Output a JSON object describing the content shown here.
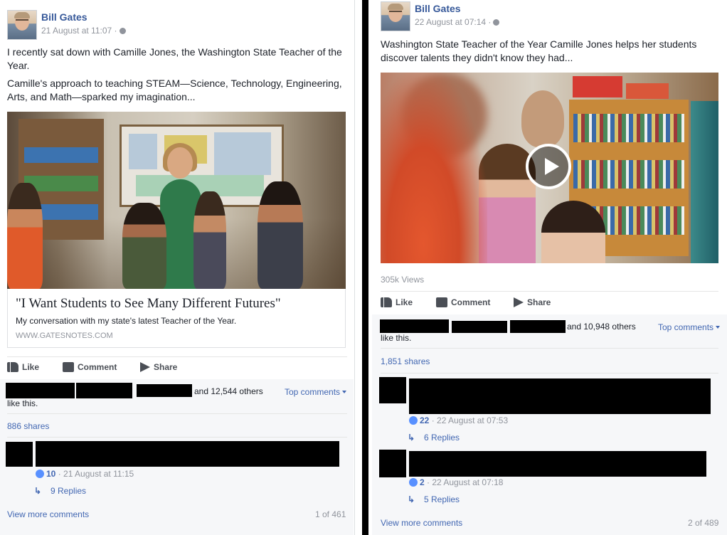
{
  "left": {
    "author": "Bill Gates",
    "timestamp": "21 August at 11:07 ·",
    "text_1": "I recently sat down with Camille Jones, the Washington State Teacher of the Year.",
    "text_2": "Camille's approach to teaching STEAM—Science, Technology, Engineering, Arts, and Math—sparked my imagination...",
    "link_title": "\"I Want Students to See Many Different Futures\"",
    "link_desc": "My conversation with my state's latest Teacher of the Year.",
    "link_domain": "WWW.GATESNOTES.COM",
    "actions": {
      "like": "Like",
      "comment": "Comment",
      "share": "Share"
    },
    "likes_text": "and 12,544 others",
    "likes_text_2": "like this.",
    "top_comments": "Top comments",
    "shares": "886 shares",
    "comments": [
      {
        "like_count": "10",
        "time": "· 21 August at 11:15",
        "replies": "9 Replies"
      }
    ],
    "view_more": "View more comments",
    "pager": "1 of 461"
  },
  "right": {
    "author": "Bill Gates",
    "timestamp": "22 August at 07:14 ·",
    "text_1": "Washington State Teacher of the Year Camille Jones helps her students discover talents they didn't know they had...",
    "views": "305k Views",
    "actions": {
      "like": "Like",
      "comment": "Comment",
      "share": "Share"
    },
    "likes_text": "and 10,948 others",
    "likes_text_2": "like this.",
    "top_comments": "Top comments",
    "shares": "1,851 shares",
    "comments": [
      {
        "like_count": "22",
        "time": "· 22 August at 07:53",
        "replies": "6 Replies"
      },
      {
        "like_count": "2",
        "time": "· 22 August at 07:18",
        "replies": "5 Replies"
      }
    ],
    "view_more": "View more comments",
    "pager": "2 of 489"
  },
  "colors": {
    "link_blue": "#365899",
    "action_gray": "#4b4f56",
    "meta_gray": "#90949c",
    "like_badge": "#5890ff"
  },
  "icons": [
    "globe-icon",
    "like-icon",
    "comment-icon",
    "share-icon",
    "play-icon",
    "reply-arrow-icon"
  ]
}
